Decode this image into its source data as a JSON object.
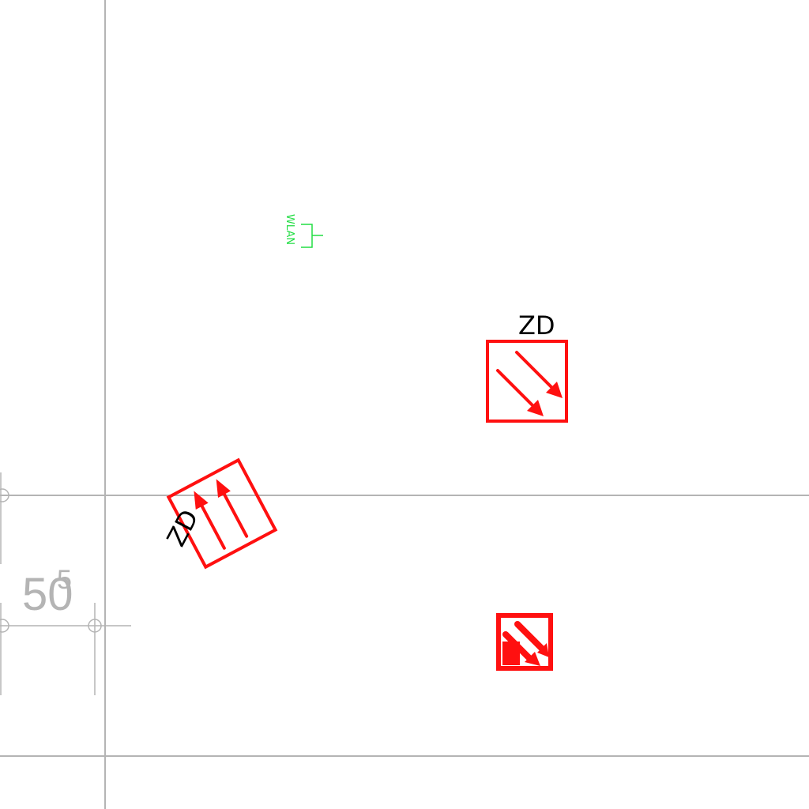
{
  "symbols": {
    "wlan": {
      "label": "WLAN"
    },
    "zd_upper": {
      "label": "ZD"
    },
    "zd_rotated": {
      "label": "ZD"
    }
  },
  "dimension": {
    "text_main": "50",
    "text_sup": "5"
  },
  "colors": {
    "grid": "#b4b4b4",
    "symbol_red": "#ff1010",
    "wlan_green": "#22dd44",
    "label_black": "#000000"
  }
}
